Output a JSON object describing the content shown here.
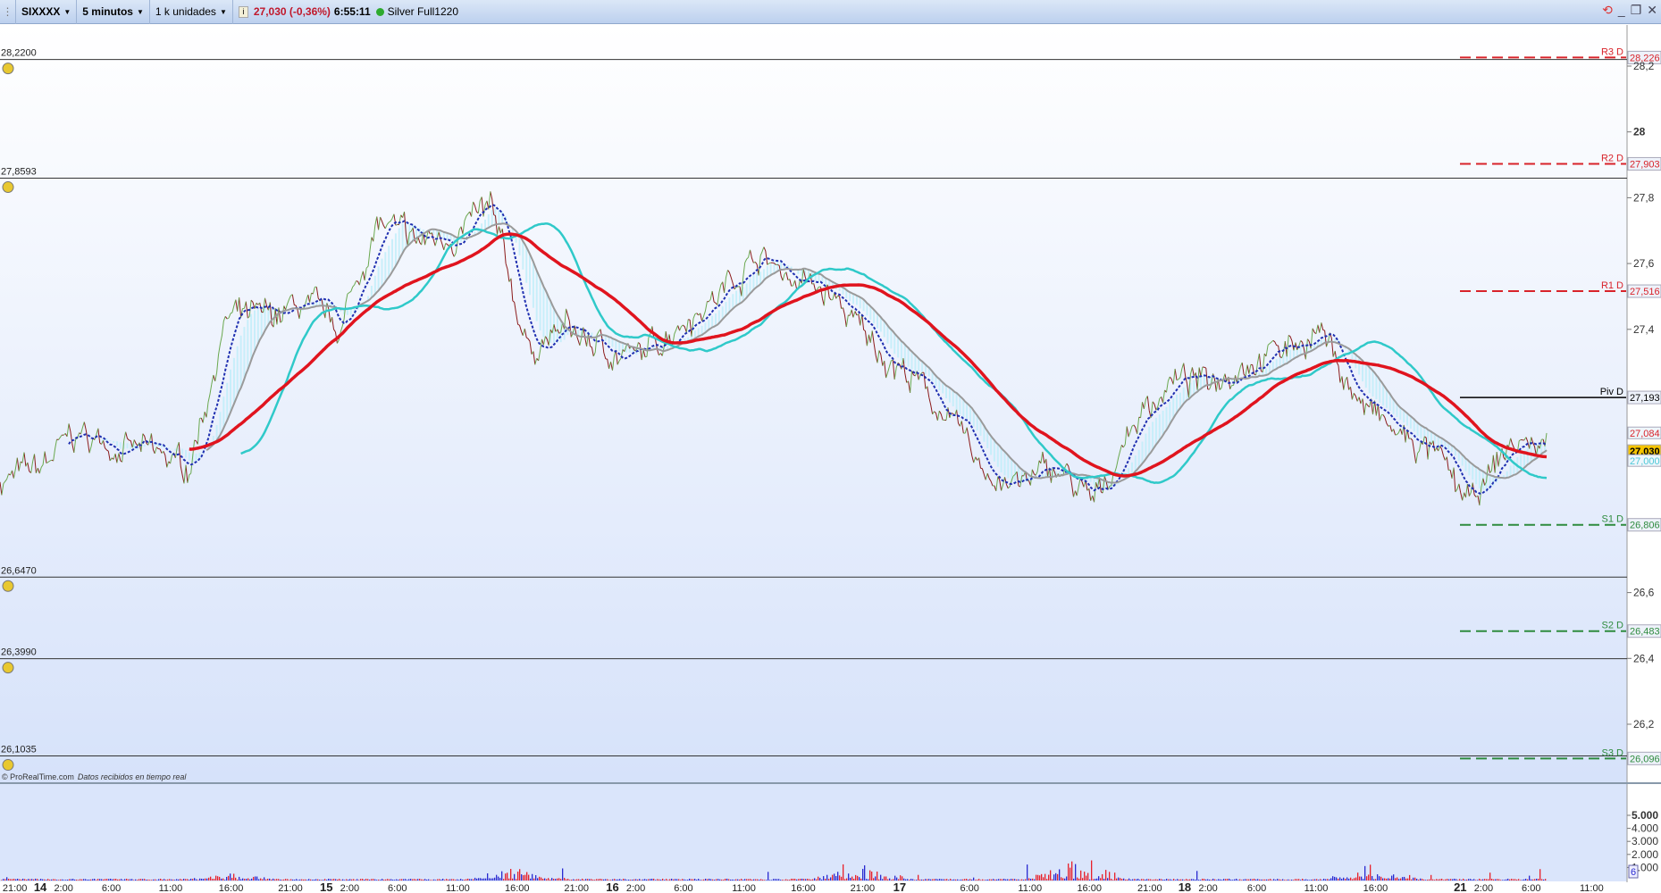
{
  "toolbar": {
    "instrument": "SIXXXX",
    "timeframe": "5 minutos",
    "units": "1 k unidades",
    "last_price": "27,030 (-0,36%)",
    "time": "6:55:11",
    "status_dot_color": "#2eaa2e",
    "feed": "Silver Full1220",
    "icons": [
      "refresh-icon",
      "minimize-icon",
      "restore-icon",
      "close-icon"
    ]
  },
  "credit": {
    "brand": "© ProRealTime.com",
    "note": "Datos recibidos en tiempo real"
  },
  "alert_lines": [
    {
      "label": "28,2200",
      "price": 28.22
    },
    {
      "label": "27,8593",
      "price": 27.8593
    },
    {
      "label": "26,6470",
      "price": 26.647
    },
    {
      "label": "26,3990",
      "price": 26.399
    },
    {
      "label": "26,1035",
      "price": 26.1035
    }
  ],
  "chart_data": {
    "type": "line",
    "price_axis": {
      "range": [
        26.05,
        28.25
      ],
      "ticks": [
        {
          "v": 28.2,
          "label": "28,2"
        },
        {
          "v": 28.0,
          "label": "28",
          "bold": true
        },
        {
          "v": 27.8,
          "label": "27,8"
        },
        {
          "v": 27.6,
          "label": "27,6"
        },
        {
          "v": 27.4,
          "label": "27,4"
        },
        {
          "v": 26.6,
          "label": "26,6"
        },
        {
          "v": 26.4,
          "label": "26,4"
        },
        {
          "v": 26.2,
          "label": "26,2"
        }
      ]
    },
    "time_axis": [
      "21:00",
      "14",
      "2:00",
      "6:00",
      "11:00",
      "16:00",
      "21:00",
      "15",
      "2:00",
      "6:00",
      "11:00",
      "16:00",
      "21:00",
      "16",
      "2:00",
      "6:00",
      "11:00",
      "16:00",
      "21:00",
      "17",
      "6:00",
      "11:00",
      "16:00",
      "21:00",
      "18",
      "2:00",
      "6:00",
      "11:00",
      "16:00",
      "21",
      "2:00",
      "6:00",
      "11:00"
    ],
    "close_keypoints": [
      26.94,
      26.97,
      27.08,
      27.05,
      27.02,
      26.98,
      27.43,
      27.43,
      27.47,
      27.4,
      27.72,
      27.66,
      27.69,
      27.76,
      27.34,
      27.4,
      27.34,
      27.31,
      27.43,
      27.5,
      27.63,
      27.56,
      27.5,
      27.37,
      27.27,
      27.15,
      26.98,
      26.92,
      26.98,
      26.86,
      27.11,
      27.24,
      27.24,
      27.31,
      27.34,
      27.4,
      27.18,
      27.08,
      27.02,
      26.86,
      27.05,
      27.05
    ],
    "pivots": [
      {
        "name": "R3 D",
        "value": "28,226",
        "price": 28.226,
        "color": "#d8232a"
      },
      {
        "name": "R2 D",
        "value": "27,903",
        "price": 27.903,
        "color": "#d8232a"
      },
      {
        "name": "R1 D",
        "value": "27,516",
        "price": 27.516,
        "color": "#d8232a"
      },
      {
        "name": "Piv D",
        "value": "27,193",
        "price": 27.193,
        "color": "#000000"
      },
      {
        "name": "S1 D",
        "value": "26,806",
        "price": 26.806,
        "color": "#2e8b3e"
      },
      {
        "name": "S2 D",
        "value": "26,483",
        "price": 26.483,
        "color": "#2e8b3e"
      },
      {
        "name": "S3 D",
        "value": "26,096",
        "price": 26.096,
        "color": "#2e8b3e"
      }
    ],
    "markers": [
      {
        "value": "27,084",
        "price": 27.084,
        "color": "#d8232a"
      },
      {
        "value": "27,030",
        "price": 27.03,
        "color": "#000000",
        "bg": "#f5c400"
      },
      {
        "value": "27,000",
        "price": 27.0,
        "color": "#4fc8d8"
      }
    ],
    "series_colors": {
      "up": "#6aa84f",
      "down": "#8b1a1a",
      "ma_long": "#e0141e",
      "ma_mid": "#2fc9c9",
      "ma_slow": "#9a9a9a",
      "ma_fast": "#1f2fb0",
      "cloud": "#bfeefa"
    },
    "volume_axis": {
      "range": [
        0,
        5300
      ],
      "ticks": [
        {
          "v": 5000,
          "label": "5.000",
          "bold": true
        },
        {
          "v": 4000,
          "label": "4.000"
        },
        {
          "v": 3000,
          "label": "3.000"
        },
        {
          "v": 2000,
          "label": "2.000"
        },
        {
          "v": 1000,
          "label": "1.000"
        }
      ],
      "current": "6"
    }
  }
}
